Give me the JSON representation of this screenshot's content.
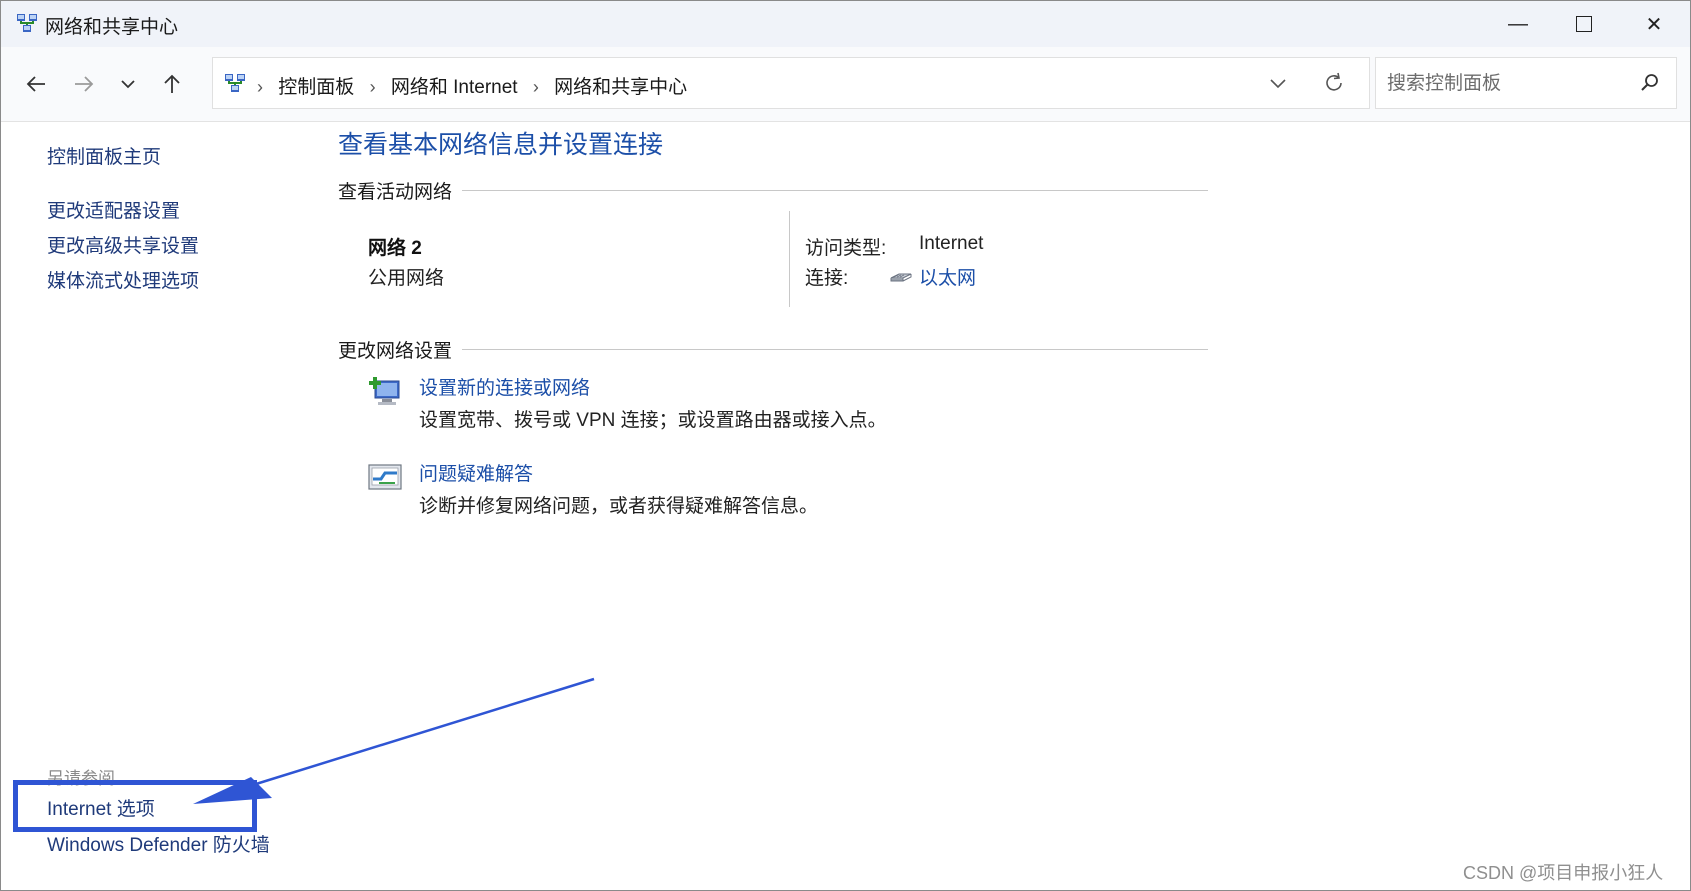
{
  "window": {
    "title": "网络和共享中心",
    "controls": {
      "minimize": "—",
      "close": "✕"
    }
  },
  "nav": {
    "back_icon": "arrow-left-icon",
    "forward_icon": "arrow-right-icon",
    "recent_icon": "chevron-down-icon",
    "up_icon": "arrow-up-icon"
  },
  "address": {
    "separator": "›",
    "breadcrumbs": [
      "控制面板",
      "网络和 Internet",
      "网络和共享中心"
    ]
  },
  "search": {
    "placeholder": "搜索控制面板",
    "value": ""
  },
  "sidebar": {
    "home": "控制面板主页",
    "items": [
      "更改适配器设置",
      "更改高级共享设置",
      "媒体流式处理选项"
    ],
    "see_also_title": "另请参阅",
    "see_also": [
      "Internet 选项",
      "Windows Defender 防火墙"
    ]
  },
  "main": {
    "title": "查看基本网络信息并设置连接",
    "active_section": "查看活动网络",
    "network": {
      "name": "网络 2",
      "category": "公用网络",
      "access_type_label": "访问类型:",
      "access_type_value": "Internet",
      "connections_label": "连接:",
      "connection_name": "以太网"
    },
    "change_section": "更改网络设置",
    "tasks": [
      {
        "link": "设置新的连接或网络",
        "desc": "设置宽带、拨号或 VPN 连接；或设置路由器或接入点。",
        "icon": "new-connection-icon"
      },
      {
        "link": "问题疑难解答",
        "desc": "诊断并修复网络问题，或者获得疑难解答信息。",
        "icon": "troubleshoot-icon"
      }
    ]
  },
  "watermark": "CSDN @项目申报小狂人",
  "colors": {
    "link": "#1c4fa8",
    "title_bar": "#f0f3f9",
    "annotation": "#2f55d4"
  }
}
